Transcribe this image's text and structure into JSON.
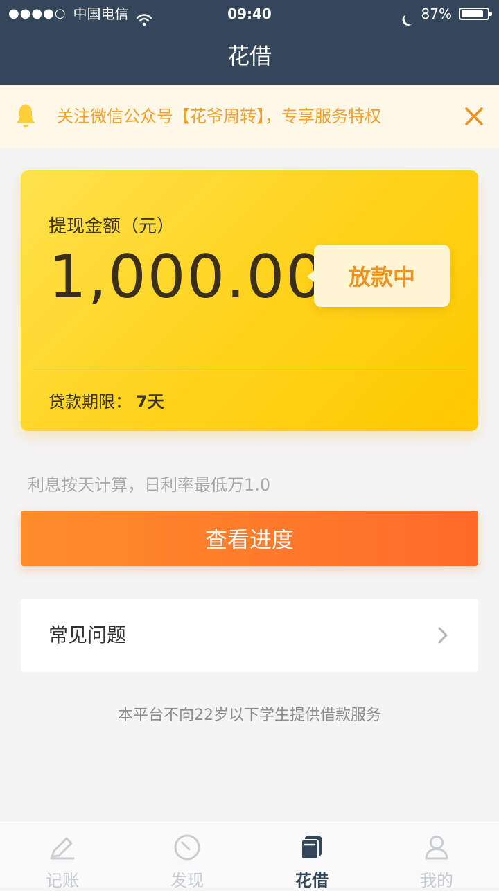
{
  "status_bar": {
    "signal": "●●●●○",
    "carrier": "中国电信",
    "time": "09:40",
    "battery_percent": "87%",
    "battery_level": 0.87,
    "moon_icon": "moon-icon",
    "wifi_icon": "wifi-icon"
  },
  "header": {
    "title": "花借"
  },
  "notice": {
    "icon": "bell-icon",
    "text": "关注微信公众号【花爷周转】，专享服务特权",
    "close_icon": "close-icon",
    "colors": {
      "background": "#fff7e7",
      "text": "#f2a12c"
    }
  },
  "card": {
    "label": "提现金额（元）",
    "amount": "1,000.00",
    "status": "放款中",
    "term_label": "贷款期限：",
    "term_value": "7天",
    "colors": {
      "from": "#ffe24d",
      "to": "#ffc800"
    }
  },
  "interest_text": "利息按天计算，日利率最低万1.0",
  "primary_button": {
    "label": "查看进度",
    "colors": {
      "from": "#ff8d2a",
      "to": "#ff6a2a"
    }
  },
  "faq": {
    "label": "常见问题",
    "chevron_icon": "chevron-right-icon"
  },
  "disclaimer": "本平台不向22岁以下学生提供借款服务",
  "tabbar": {
    "items": [
      {
        "label": "记账",
        "icon": "pencil-icon",
        "active": false
      },
      {
        "label": "发现",
        "icon": "compass-icon",
        "active": false
      },
      {
        "label": "花借",
        "icon": "stack-icon",
        "active": true
      },
      {
        "label": "我的",
        "icon": "user-icon",
        "active": false
      }
    ]
  },
  "brand_color": "#34475a"
}
